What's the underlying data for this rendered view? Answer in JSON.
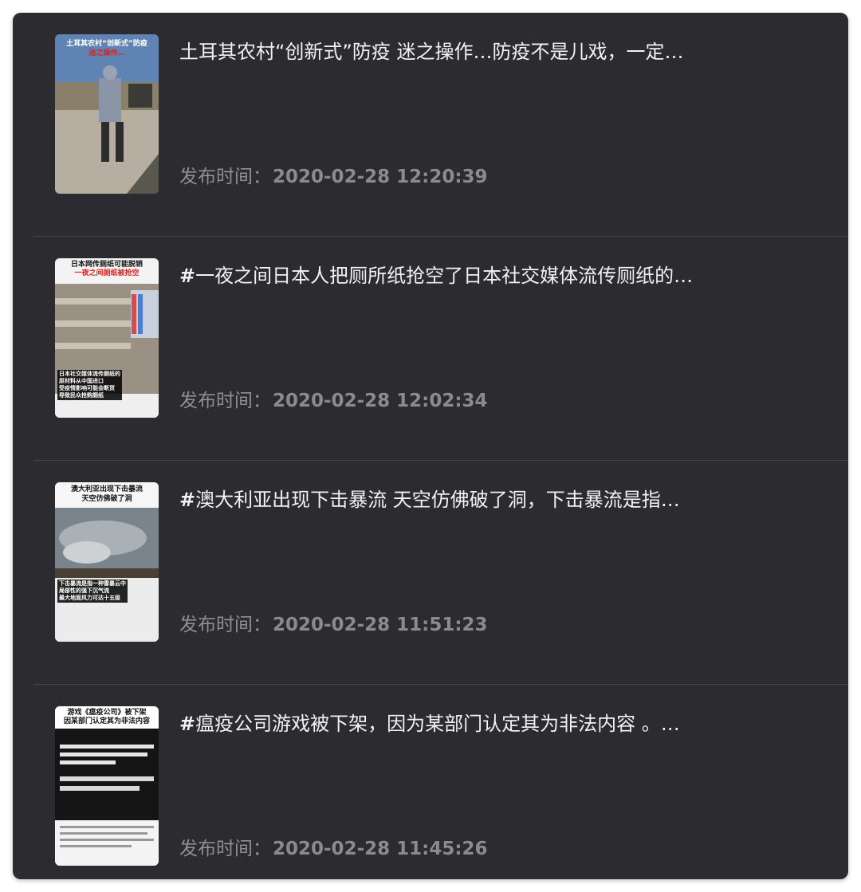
{
  "feed": {
    "publish_label": "发布时间：",
    "items": [
      {
        "title": "土耳其农村“创新式”防疫 迷之操作…防疫不是儿戏，一定…",
        "hash": "",
        "time": "2020-02-28 12:20:39",
        "thumb": {
          "caption_line1": "土耳其农村“创新式”防疫",
          "caption_line2": "迷之操作…",
          "overlay": ""
        }
      },
      {
        "title": "一夜之间日本人把厕所纸抢空了日本社交媒体流传厕纸的…",
        "hash": "#",
        "time": "2020-02-28 12:02:34",
        "thumb": {
          "caption_line1": "日本网传厕纸可能脱销",
          "caption_line2": "一夜之间厕纸被抢空",
          "overlay": "日本社交媒体流传厕纸的\n原材料从中国进口\n受疫情影响可能会断货\n导致民众抢购厕纸"
        }
      },
      {
        "title": "澳大利亚出现下击暴流 天空仿佛破了洞，下击暴流是指…",
        "hash": "#",
        "time": "2020-02-28 11:51:23",
        "thumb": {
          "caption_line1": "澳大利亚出现下击暴流",
          "caption_line2": "天空仿佛破了洞",
          "overlay": "下击暴流是指一种雷暴云中\n局部性的强下沉气流\n最大地面风力可达十五级"
        }
      },
      {
        "title": "瘟疫公司游戏被下架，因为某部门认定其为非法内容 。…",
        "hash": "#",
        "time": "2020-02-28 11:45:26",
        "thumb": {
          "caption_line1": "游戏《瘟疫公司》被下架",
          "caption_line2": "因某部门认定其为非法内容",
          "overlay": ""
        }
      }
    ]
  }
}
